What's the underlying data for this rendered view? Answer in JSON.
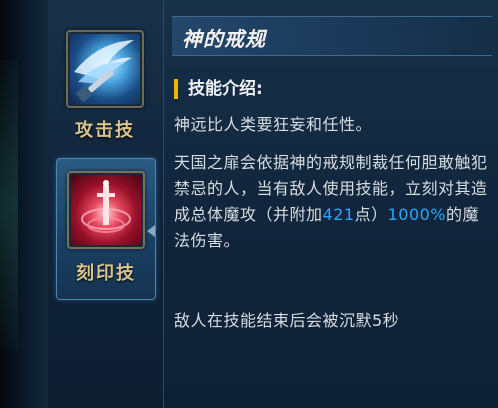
{
  "skills": [
    {
      "name": "攻击技",
      "icon": "ice-sword-icon",
      "selected": false
    },
    {
      "name": "刻印技",
      "icon": "red-sword-seal-icon",
      "selected": true
    }
  ],
  "detail": {
    "title": "神的戒规",
    "section_heading": "技能介绍:",
    "paragraph1": "神远比人类要狂妄和任性。",
    "paragraph2_part1": "天国之扉会依据神的戒规制裁任何胆敢触犯禁忌的人，当有敌人使用技能，立刻对其造成总体魔攻（并附加",
    "paragraph2_value1": "421",
    "paragraph2_part2": "点）",
    "paragraph2_value2": "1000%",
    "paragraph2_part3": "的魔法伤害。",
    "paragraph3": "敌人在技能结束后会被沉默5秒"
  },
  "colors": {
    "skill_name": "#d9c48d",
    "highlight": "#2aa8ff",
    "section_bar": "#f0b400"
  }
}
